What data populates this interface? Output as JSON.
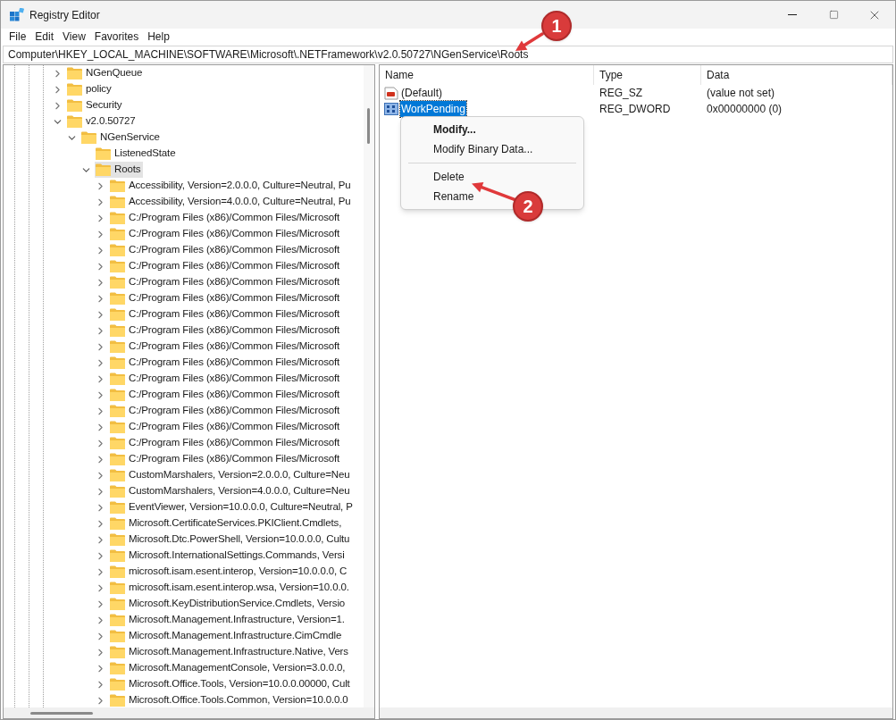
{
  "window": {
    "title": "Registry Editor"
  },
  "menu": [
    "File",
    "Edit",
    "View",
    "Favorites",
    "Help"
  ],
  "address": "Computer\\HKEY_LOCAL_MACHINE\\SOFTWARE\\Microsoft\\.NETFramework\\v2.0.50727\\NGenService\\Roots",
  "tree": [
    {
      "label": "NGenQueue",
      "expanded": false,
      "selected": false
    },
    {
      "label": "policy",
      "expanded": false,
      "selected": false
    },
    {
      "label": "Security",
      "expanded": false,
      "selected": false
    },
    {
      "label": "v2.0.50727",
      "expanded": true,
      "selected": false,
      "children": [
        {
          "label": "NGenService",
          "expanded": true,
          "selected": false,
          "children": [
            {
              "label": "ListenedState",
              "selected": false
            },
            {
              "label": "Roots",
              "expanded": true,
              "selected": true,
              "children": [
                {
                  "label": "Accessibility, Version=2.0.0.0, Culture=Neutral, Pu",
                  "expanded": false,
                  "selected": false
                },
                {
                  "label": "Accessibility, Version=4.0.0.0, Culture=Neutral, Pu",
                  "expanded": false,
                  "selected": false
                },
                {
                  "label": "C:/Program Files (x86)/Common Files/Microsoft",
                  "expanded": false,
                  "selected": false
                },
                {
                  "label": "C:/Program Files (x86)/Common Files/Microsoft",
                  "expanded": false,
                  "selected": false
                },
                {
                  "label": "C:/Program Files (x86)/Common Files/Microsoft",
                  "expanded": false,
                  "selected": false
                },
                {
                  "label": "C:/Program Files (x86)/Common Files/Microsoft",
                  "expanded": false,
                  "selected": false
                },
                {
                  "label": "C:/Program Files (x86)/Common Files/Microsoft",
                  "expanded": false,
                  "selected": false
                },
                {
                  "label": "C:/Program Files (x86)/Common Files/Microsoft",
                  "expanded": false,
                  "selected": false
                },
                {
                  "label": "C:/Program Files (x86)/Common Files/Microsoft",
                  "expanded": false,
                  "selected": false
                },
                {
                  "label": "C:/Program Files (x86)/Common Files/Microsoft",
                  "expanded": false,
                  "selected": false
                },
                {
                  "label": "C:/Program Files (x86)/Common Files/Microsoft",
                  "expanded": false,
                  "selected": false
                },
                {
                  "label": "C:/Program Files (x86)/Common Files/Microsoft",
                  "expanded": false,
                  "selected": false
                },
                {
                  "label": "C:/Program Files (x86)/Common Files/Microsoft",
                  "expanded": false,
                  "selected": false
                },
                {
                  "label": "C:/Program Files (x86)/Common Files/Microsoft",
                  "expanded": false,
                  "selected": false
                },
                {
                  "label": "C:/Program Files (x86)/Common Files/Microsoft",
                  "expanded": false,
                  "selected": false
                },
                {
                  "label": "C:/Program Files (x86)/Common Files/Microsoft",
                  "expanded": false,
                  "selected": false
                },
                {
                  "label": "C:/Program Files (x86)/Common Files/Microsoft",
                  "expanded": false,
                  "selected": false
                },
                {
                  "label": "C:/Program Files (x86)/Common Files/Microsoft",
                  "expanded": false,
                  "selected": false
                },
                {
                  "label": "CustomMarshalers, Version=2.0.0.0, Culture=Neu",
                  "expanded": false,
                  "selected": false
                },
                {
                  "label": "CustomMarshalers, Version=4.0.0.0, Culture=Neu",
                  "expanded": false,
                  "selected": false
                },
                {
                  "label": "EventViewer, Version=10.0.0.0, Culture=Neutral, P",
                  "expanded": false,
                  "selected": false
                },
                {
                  "label": "Microsoft.CertificateServices.PKIClient.Cmdlets,",
                  "expanded": false,
                  "selected": false
                },
                {
                  "label": "Microsoft.Dtc.PowerShell, Version=10.0.0.0, Cultu",
                  "expanded": false,
                  "selected": false
                },
                {
                  "label": "Microsoft.InternationalSettings.Commands, Versi",
                  "expanded": false,
                  "selected": false
                },
                {
                  "label": "microsoft.isam.esent.interop, Version=10.0.0.0, C",
                  "expanded": false,
                  "selected": false
                },
                {
                  "label": "microsoft.isam.esent.interop.wsa, Version=10.0.0.",
                  "expanded": false,
                  "selected": false
                },
                {
                  "label": "Microsoft.KeyDistributionService.Cmdlets, Versio",
                  "expanded": false,
                  "selected": false
                },
                {
                  "label": "Microsoft.Management.Infrastructure, Version=1.",
                  "expanded": false,
                  "selected": false
                },
                {
                  "label": "Microsoft.Management.Infrastructure.CimCmdle",
                  "expanded": false,
                  "selected": false
                },
                {
                  "label": "Microsoft.Management.Infrastructure.Native, Vers",
                  "expanded": false,
                  "selected": false
                },
                {
                  "label": "Microsoft.ManagementConsole, Version=3.0.0.0,",
                  "expanded": false,
                  "selected": false
                },
                {
                  "label": "Microsoft.Office.Tools, Version=10.0.0.00000, Cult",
                  "expanded": false,
                  "selected": false
                },
                {
                  "label": "Microsoft.Office.Tools.Common, Version=10.0.0.0",
                  "expanded": false,
                  "selected": false
                }
              ]
            }
          ]
        }
      ]
    }
  ],
  "list": {
    "columns": [
      "Name",
      "Type",
      "Data"
    ],
    "rows": [
      {
        "kind": "string",
        "name": "(Default)",
        "type": "REG_SZ",
        "data": "(value not set)",
        "selected": false
      },
      {
        "kind": "binary",
        "name": "WorkPending",
        "type": "REG_DWORD",
        "data": "0x00000000 (0)",
        "selected": true
      }
    ]
  },
  "context_menu": [
    {
      "kind": "item",
      "label": "Modify...",
      "default": true
    },
    {
      "kind": "item",
      "label": "Modify Binary Data...",
      "default": false
    },
    {
      "kind": "separator"
    },
    {
      "kind": "item",
      "label": "Delete",
      "default": false
    },
    {
      "kind": "item",
      "label": "Rename",
      "default": false
    }
  ],
  "annotations": [
    "1",
    "2"
  ]
}
